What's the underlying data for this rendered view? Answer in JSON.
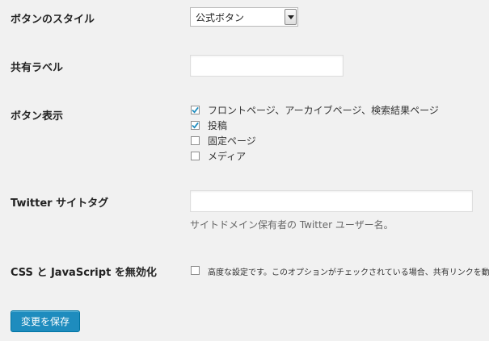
{
  "form": {
    "style_label": "ボタンのスタイル",
    "style_select": {
      "selected": "公式ボタン"
    },
    "share_label": "共有ラベル",
    "share_input": {
      "value": ""
    },
    "display_label": "ボタン表示",
    "display_options": [
      {
        "label": "フロントページ、アーカイブページ、検索結果ページ",
        "checked": true
      },
      {
        "label": "投稿",
        "checked": true
      },
      {
        "label": "固定ページ",
        "checked": false
      },
      {
        "label": "メディア",
        "checked": false
      }
    ],
    "twitter_label": "Twitter サイトタグ",
    "twitter_input": {
      "value": ""
    },
    "twitter_description": "サイトドメイン保有者の Twitter ユーザー名。",
    "disable_label": "CSS と JavaScript を無効化",
    "disable_option": {
      "label": "高度な設定です。このオプションがチェックされている場合、共有リンクを動作",
      "checked": false
    },
    "save_button": "変更を保存"
  },
  "colors": {
    "background": "#f1f1f1",
    "primary_button": "#1e8cbe",
    "check_mark": "#1e8cbe"
  }
}
